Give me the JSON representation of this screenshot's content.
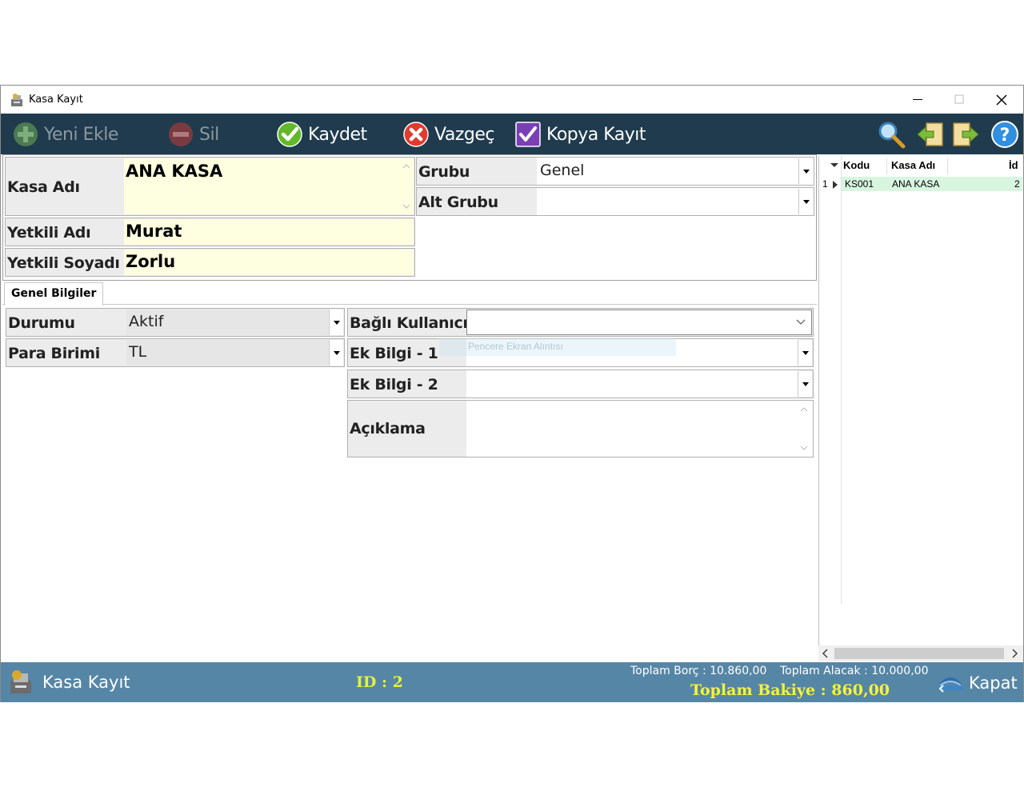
{
  "window": {
    "title": "Kasa Kayıt"
  },
  "toolbar": {
    "yeni_ekle": "Yeni Ekle",
    "sil": "Sil",
    "kaydet": "Kaydet",
    "vazgec": "Vazgeç",
    "kopya_kayit": "Kopya Kayıt"
  },
  "form": {
    "kasa_adi_label": "Kasa Adı",
    "kasa_adi_value": "ANA KASA",
    "yetkili_adi_label": "Yetkili Adı",
    "yetkili_adi_value": "Murat",
    "yetkili_soyadi_label": "Yetkili Soyadı",
    "yetkili_soyadi_value": "Zorlu",
    "grubu_label": "Grubu",
    "grubu_value": "Genel",
    "alt_grubu_label": "Alt Grubu",
    "alt_grubu_value": ""
  },
  "tabs": {
    "genel_bilgiler": "Genel Bilgiler"
  },
  "genel": {
    "durumu_label": "Durumu",
    "durumu_value": "Aktif",
    "para_birimi_label": "Para Birimi",
    "para_birimi_value": "TL",
    "bagli_kullanici_label": "Bağlı Kullanıcı",
    "bagli_kullanici_value": "",
    "ek_bilgi_1_label": "Ek Bilgi - 1",
    "ek_bilgi_1_value": "",
    "ek_bilgi_2_label": "Ek Bilgi - 2",
    "ek_bilgi_2_value": "",
    "aciklama_label": "Açıklama",
    "aciklama_value": "",
    "ghost_text": "Pencere Ekran Alıntısı"
  },
  "grid": {
    "columns": [
      "Kodu",
      "Kasa Adı",
      "İd"
    ],
    "rows": [
      {
        "no": "1",
        "kodu": "KS001",
        "kasa_adi": "ANA KASA",
        "id": "2"
      }
    ]
  },
  "status": {
    "title": "Kasa Kayıt",
    "id_text": "ID : 2",
    "toplam_borc": "Toplam Borç : 10.860,00",
    "toplam_alacak": "Toplam Alacak : 10.000,00",
    "toplam_bakiye": "Toplam Bakiye : 860,00",
    "kapat": "Kapat"
  },
  "colors": {
    "toolbar_bg": "#1f3b4d",
    "status_bg": "#5686a6",
    "input_yellow": "#fefee0",
    "grid_selected": "#d8f5e0",
    "bakiye_text": "#f6f23a"
  }
}
